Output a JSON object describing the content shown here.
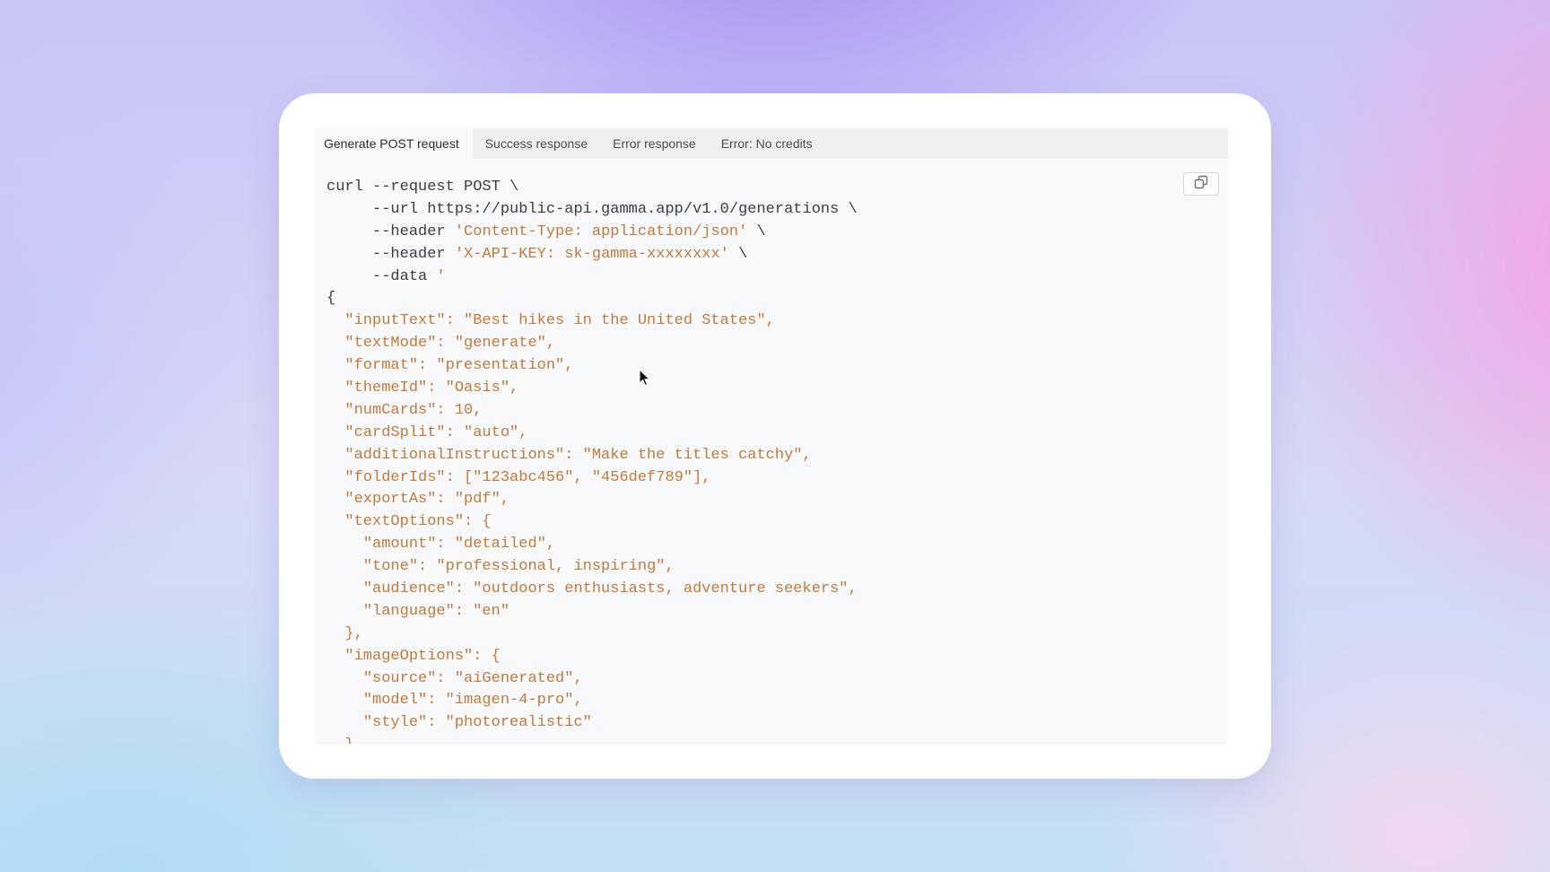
{
  "tabs": [
    {
      "label": "Generate POST request",
      "active": true
    },
    {
      "label": "Success response",
      "active": false
    },
    {
      "label": "Error response",
      "active": false
    },
    {
      "label": "Error: No credits",
      "active": false
    }
  ],
  "copy_button": {
    "icon": "copy-icon"
  },
  "code_lines": [
    {
      "indent": "",
      "text": "curl --request POST \\",
      "str": "",
      "suffix": ""
    },
    {
      "indent": "     ",
      "text": "--url https://public-api.gamma.app/v1.0/generations \\",
      "str": "",
      "suffix": ""
    },
    {
      "indent": "     ",
      "text": "--header ",
      "str": "'Content-Type: application/json'",
      "suffix": " \\"
    },
    {
      "indent": "     ",
      "text": "--header ",
      "str": "'X-API-KEY: sk-gamma-xxxxxxxx'",
      "suffix": " \\"
    },
    {
      "indent": "     ",
      "text": "--data ",
      "str": "'",
      "suffix": ""
    },
    {
      "indent": "",
      "text": "{",
      "str": "",
      "suffix": ""
    },
    {
      "indent": "  ",
      "text": "",
      "str": "\"inputText\": \"Best hikes in the United States\",",
      "suffix": ""
    },
    {
      "indent": "  ",
      "text": "",
      "str": "\"textMode\": \"generate\",",
      "suffix": ""
    },
    {
      "indent": "  ",
      "text": "",
      "str": "\"format\": \"presentation\",",
      "suffix": ""
    },
    {
      "indent": "  ",
      "text": "",
      "str": "\"themeId\": \"Oasis\",",
      "suffix": ""
    },
    {
      "indent": "  ",
      "text": "",
      "str": "\"numCards\": 10,",
      "suffix": ""
    },
    {
      "indent": "  ",
      "text": "",
      "str": "\"cardSplit\": \"auto\",",
      "suffix": ""
    },
    {
      "indent": "  ",
      "text": "",
      "str": "\"additionalInstructions\": \"Make the titles catchy\",",
      "suffix": ""
    },
    {
      "indent": "  ",
      "text": "",
      "str": "\"folderIds\": [\"123abc456\", \"456def789\"],",
      "suffix": ""
    },
    {
      "indent": "  ",
      "text": "",
      "str": "\"exportAs\": \"pdf\",",
      "suffix": ""
    },
    {
      "indent": "  ",
      "text": "",
      "str": "\"textOptions\": {",
      "suffix": ""
    },
    {
      "indent": "    ",
      "text": "",
      "str": "\"amount\": \"detailed\",",
      "suffix": ""
    },
    {
      "indent": "    ",
      "text": "",
      "str": "\"tone\": \"professional, inspiring\",",
      "suffix": ""
    },
    {
      "indent": "    ",
      "text": "",
      "str": "\"audience\": \"outdoors enthusiasts, adventure seekers\",",
      "suffix": ""
    },
    {
      "indent": "    ",
      "text": "",
      "str": "\"language\": \"en\"",
      "suffix": ""
    },
    {
      "indent": "  ",
      "text": "",
      "str": "},",
      "suffix": ""
    },
    {
      "indent": "  ",
      "text": "",
      "str": "\"imageOptions\": {",
      "suffix": ""
    },
    {
      "indent": "    ",
      "text": "",
      "str": "\"source\": \"aiGenerated\",",
      "suffix": ""
    },
    {
      "indent": "    ",
      "text": "",
      "str": "\"model\": \"imagen-4-pro\",",
      "suffix": ""
    },
    {
      "indent": "    ",
      "text": "",
      "str": "\"style\": \"photorealistic\"",
      "suffix": ""
    },
    {
      "indent": "  ",
      "text": "",
      "str": "},",
      "suffix": ""
    }
  ],
  "colors": {
    "code_text": "#3a3d44",
    "code_string": "#c07a3a",
    "tab_bar": "#efeff1",
    "panel": "#f8f9fb"
  }
}
